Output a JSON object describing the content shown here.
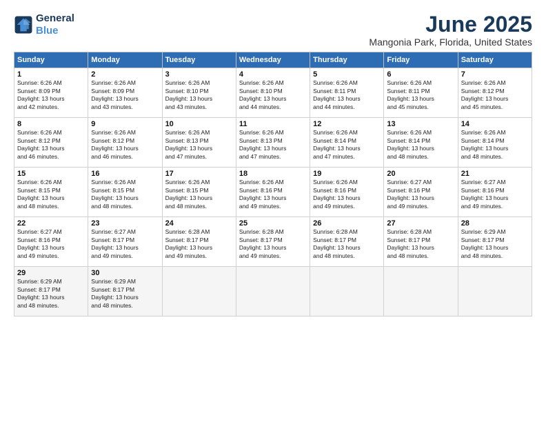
{
  "logo": {
    "line1": "General",
    "line2": "Blue"
  },
  "title": "June 2025",
  "subtitle": "Mangonia Park, Florida, United States",
  "days_of_week": [
    "Sunday",
    "Monday",
    "Tuesday",
    "Wednesday",
    "Thursday",
    "Friday",
    "Saturday"
  ],
  "weeks": [
    [
      {
        "day": "1",
        "sunrise": "6:26 AM",
        "sunset": "8:09 PM",
        "daylight": "13 hours and 42 minutes."
      },
      {
        "day": "2",
        "sunrise": "6:26 AM",
        "sunset": "8:09 PM",
        "daylight": "13 hours and 43 minutes."
      },
      {
        "day": "3",
        "sunrise": "6:26 AM",
        "sunset": "8:10 PM",
        "daylight": "13 hours and 43 minutes."
      },
      {
        "day": "4",
        "sunrise": "6:26 AM",
        "sunset": "8:10 PM",
        "daylight": "13 hours and 44 minutes."
      },
      {
        "day": "5",
        "sunrise": "6:26 AM",
        "sunset": "8:11 PM",
        "daylight": "13 hours and 44 minutes."
      },
      {
        "day": "6",
        "sunrise": "6:26 AM",
        "sunset": "8:11 PM",
        "daylight": "13 hours and 45 minutes."
      },
      {
        "day": "7",
        "sunrise": "6:26 AM",
        "sunset": "8:12 PM",
        "daylight": "13 hours and 45 minutes."
      }
    ],
    [
      {
        "day": "8",
        "sunrise": "6:26 AM",
        "sunset": "8:12 PM",
        "daylight": "13 hours and 46 minutes."
      },
      {
        "day": "9",
        "sunrise": "6:26 AM",
        "sunset": "8:12 PM",
        "daylight": "13 hours and 46 minutes."
      },
      {
        "day": "10",
        "sunrise": "6:26 AM",
        "sunset": "8:13 PM",
        "daylight": "13 hours and 47 minutes."
      },
      {
        "day": "11",
        "sunrise": "6:26 AM",
        "sunset": "8:13 PM",
        "daylight": "13 hours and 47 minutes."
      },
      {
        "day": "12",
        "sunrise": "6:26 AM",
        "sunset": "8:14 PM",
        "daylight": "13 hours and 47 minutes."
      },
      {
        "day": "13",
        "sunrise": "6:26 AM",
        "sunset": "8:14 PM",
        "daylight": "13 hours and 48 minutes."
      },
      {
        "day": "14",
        "sunrise": "6:26 AM",
        "sunset": "8:14 PM",
        "daylight": "13 hours and 48 minutes."
      }
    ],
    [
      {
        "day": "15",
        "sunrise": "6:26 AM",
        "sunset": "8:15 PM",
        "daylight": "13 hours and 48 minutes."
      },
      {
        "day": "16",
        "sunrise": "6:26 AM",
        "sunset": "8:15 PM",
        "daylight": "13 hours and 48 minutes."
      },
      {
        "day": "17",
        "sunrise": "6:26 AM",
        "sunset": "8:15 PM",
        "daylight": "13 hours and 48 minutes."
      },
      {
        "day": "18",
        "sunrise": "6:26 AM",
        "sunset": "8:16 PM",
        "daylight": "13 hours and 49 minutes."
      },
      {
        "day": "19",
        "sunrise": "6:26 AM",
        "sunset": "8:16 PM",
        "daylight": "13 hours and 49 minutes."
      },
      {
        "day": "20",
        "sunrise": "6:27 AM",
        "sunset": "8:16 PM",
        "daylight": "13 hours and 49 minutes."
      },
      {
        "day": "21",
        "sunrise": "6:27 AM",
        "sunset": "8:16 PM",
        "daylight": "13 hours and 49 minutes."
      }
    ],
    [
      {
        "day": "22",
        "sunrise": "6:27 AM",
        "sunset": "8:16 PM",
        "daylight": "13 hours and 49 minutes."
      },
      {
        "day": "23",
        "sunrise": "6:27 AM",
        "sunset": "8:17 PM",
        "daylight": "13 hours and 49 minutes."
      },
      {
        "day": "24",
        "sunrise": "6:28 AM",
        "sunset": "8:17 PM",
        "daylight": "13 hours and 49 minutes."
      },
      {
        "day": "25",
        "sunrise": "6:28 AM",
        "sunset": "8:17 PM",
        "daylight": "13 hours and 49 minutes."
      },
      {
        "day": "26",
        "sunrise": "6:28 AM",
        "sunset": "8:17 PM",
        "daylight": "13 hours and 48 minutes."
      },
      {
        "day": "27",
        "sunrise": "6:28 AM",
        "sunset": "8:17 PM",
        "daylight": "13 hours and 48 minutes."
      },
      {
        "day": "28",
        "sunrise": "6:29 AM",
        "sunset": "8:17 PM",
        "daylight": "13 hours and 48 minutes."
      }
    ],
    [
      {
        "day": "29",
        "sunrise": "6:29 AM",
        "sunset": "8:17 PM",
        "daylight": "13 hours and 48 minutes."
      },
      {
        "day": "30",
        "sunrise": "6:29 AM",
        "sunset": "8:17 PM",
        "daylight": "13 hours and 48 minutes."
      },
      null,
      null,
      null,
      null,
      null
    ]
  ],
  "labels": {
    "sunrise": "Sunrise:",
    "sunset": "Sunset:",
    "daylight": "Daylight:"
  }
}
